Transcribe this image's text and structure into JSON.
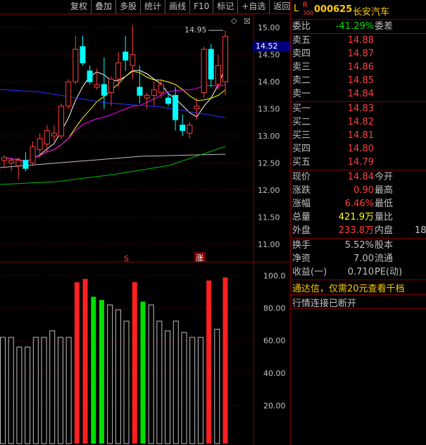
{
  "toolbar": [
    "复权",
    "叠加",
    "多股",
    "统计",
    "画线",
    "F10",
    "标记",
    "+自选",
    "返回"
  ],
  "stock": {
    "market_letter": "L",
    "r_badge": "R",
    "r_num": "300",
    "code": "000625",
    "name": "长安汽车"
  },
  "current_price_tag": "14.52",
  "high_label": "14.95",
  "price_axis": [
    "15.00",
    "14.50",
    "14.00",
    "13.50",
    "13.00",
    "12.50",
    "12.00",
    "11.50",
    "11.00"
  ],
  "vol_axis": [
    "100.0",
    "80.00",
    "60.00",
    "40.00",
    "20.00"
  ],
  "markers": {
    "s": "S",
    "zhang": "涨"
  },
  "quote": {
    "webi": {
      "label": "委比",
      "value": "-41.29%",
      "label2": "委差"
    },
    "sell": [
      {
        "label": "卖五",
        "price": "14.88"
      },
      {
        "label": "卖四",
        "price": "14.87"
      },
      {
        "label": "卖三",
        "price": "14.86"
      },
      {
        "label": "卖二",
        "price": "14.85"
      },
      {
        "label": "卖一",
        "price": "14.84"
      }
    ],
    "buy": [
      {
        "label": "买一",
        "price": "14.83"
      },
      {
        "label": "买二",
        "price": "14.82"
      },
      {
        "label": "买三",
        "price": "14.81"
      },
      {
        "label": "买四",
        "price": "14.80"
      },
      {
        "label": "买五",
        "price": "14.79"
      }
    ],
    "stats": [
      {
        "label": "现价",
        "value": "14.84",
        "label2": "今开"
      },
      {
        "label": "涨跌",
        "value": "0.90",
        "label2": "最高"
      },
      {
        "label": "涨幅",
        "value": "6.46%",
        "label2": "最低"
      },
      {
        "label": "总量",
        "value": "421.9万",
        "label2": "量比"
      },
      {
        "label": "外盘",
        "value": "233.8万",
        "label2": "内盘",
        "value2": "18"
      }
    ],
    "stats2": [
      {
        "label": "换手",
        "value": "5.52%",
        "label2": "股本"
      },
      {
        "label": "净资",
        "value": "7.00",
        "label2": "流通"
      },
      {
        "label": "收益(一)",
        "value": "0.710",
        "label2": "PE(动)"
      }
    ]
  },
  "ad_text": "通达信，仅需20元查看千档",
  "status_text": "行情连接已断开",
  "colors": {
    "up": "#ff4040",
    "down": "#00ffff",
    "panel_border": "#800000"
  },
  "chart_data": {
    "type": "candlestick",
    "price_ylim": [
      10.7,
      15.25
    ],
    "candles": [
      {
        "o": 12.55,
        "h": 12.65,
        "l": 12.4,
        "c": 12.6
      },
      {
        "o": 12.5,
        "h": 12.6,
        "l": 12.35,
        "c": 12.55
      },
      {
        "o": 12.45,
        "h": 12.6,
        "l": 12.2,
        "c": 12.55
      },
      {
        "o": 12.55,
        "h": 12.7,
        "l": 12.35,
        "c": 12.4
      },
      {
        "o": 12.5,
        "h": 12.9,
        "l": 12.45,
        "c": 12.8
      },
      {
        "o": 12.75,
        "h": 13.05,
        "l": 12.6,
        "c": 12.95
      },
      {
        "o": 12.85,
        "h": 13.2,
        "l": 12.7,
        "c": 13.1
      },
      {
        "o": 13.0,
        "h": 13.2,
        "l": 12.9,
        "c": 13.05
      },
      {
        "o": 13.0,
        "h": 13.6,
        "l": 12.95,
        "c": 13.55
      },
      {
        "o": 13.55,
        "h": 14.05,
        "l": 13.5,
        "c": 14.0
      },
      {
        "o": 14.0,
        "h": 14.85,
        "l": 13.95,
        "c": 14.6
      },
      {
        "o": 14.65,
        "h": 14.85,
        "l": 14.3,
        "c": 14.35
      },
      {
        "o": 14.2,
        "h": 14.3,
        "l": 13.95,
        "c": 14.0
      },
      {
        "o": 13.9,
        "h": 14.25,
        "l": 13.85,
        "c": 13.95
      },
      {
        "o": 13.95,
        "h": 14.45,
        "l": 13.5,
        "c": 13.75
      },
      {
        "o": 13.8,
        "h": 14.1,
        "l": 13.55,
        "c": 14.05
      },
      {
        "o": 14.05,
        "h": 14.55,
        "l": 13.9,
        "c": 14.35
      },
      {
        "o": 14.55,
        "h": 14.85,
        "l": 14.2,
        "c": 14.4
      },
      {
        "o": 14.3,
        "h": 15.05,
        "l": 14.05,
        "c": 14.5
      },
      {
        "o": 13.9,
        "h": 14.3,
        "l": 13.6,
        "c": 13.75
      },
      {
        "o": 13.7,
        "h": 13.8,
        "l": 13.5,
        "c": 13.75
      },
      {
        "o": 13.75,
        "h": 14.0,
        "l": 13.55,
        "c": 13.85
      },
      {
        "o": 13.8,
        "h": 14.05,
        "l": 13.7,
        "c": 13.95
      },
      {
        "o": 13.7,
        "h": 13.8,
        "l": 13.55,
        "c": 13.6
      },
      {
        "o": 13.75,
        "h": 13.9,
        "l": 13.1,
        "c": 13.3
      },
      {
        "o": 13.2,
        "h": 13.4,
        "l": 13.0,
        "c": 13.1
      },
      {
        "o": 13.05,
        "h": 13.25,
        "l": 12.95,
        "c": 13.2
      },
      {
        "o": 13.5,
        "h": 13.7,
        "l": 13.3,
        "c": 13.55
      },
      {
        "o": 13.8,
        "h": 14.65,
        "l": 13.7,
        "c": 14.6
      },
      {
        "o": 14.6,
        "h": 14.7,
        "l": 13.9,
        "c": 14.05
      },
      {
        "o": 13.95,
        "h": 14.5,
        "l": 13.85,
        "c": 14.3
      },
      {
        "o": 14.0,
        "h": 14.95,
        "l": 13.75,
        "c": 14.84
      }
    ],
    "volume_ylim": [
      0,
      105
    ],
    "volume": [
      [
        62,
        "g"
      ],
      [
        62,
        "g"
      ],
      [
        56,
        "g"
      ],
      [
        56,
        "g"
      ],
      [
        62,
        "g"
      ],
      [
        62,
        "g"
      ],
      [
        66,
        "g"
      ],
      [
        62,
        "g"
      ],
      [
        62,
        "g"
      ],
      [
        96,
        "r"
      ],
      [
        98,
        "r"
      ],
      [
        87,
        "c"
      ],
      [
        85,
        "c"
      ],
      [
        82,
        "g"
      ],
      [
        79,
        "g"
      ],
      [
        72,
        "g"
      ],
      [
        96,
        "r"
      ],
      [
        84,
        "c"
      ],
      [
        82,
        "g"
      ],
      [
        72,
        "g"
      ],
      [
        66,
        "g"
      ],
      [
        72,
        "g"
      ],
      [
        65,
        "g"
      ],
      [
        62,
        "g"
      ],
      [
        62,
        "g"
      ],
      [
        97,
        "r"
      ],
      [
        67,
        "g"
      ],
      [
        99,
        "r"
      ]
    ]
  }
}
